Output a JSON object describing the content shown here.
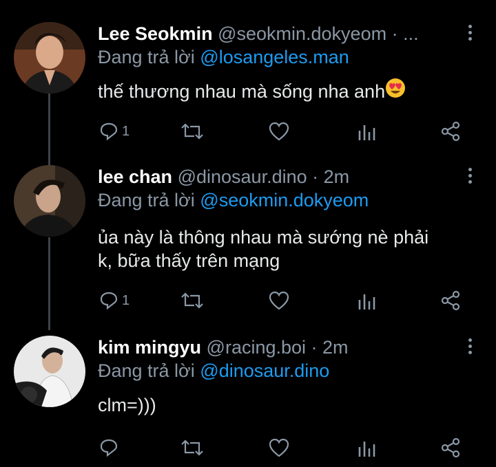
{
  "tweets": [
    {
      "name": "Lee Seokmin",
      "handle": "@seokmin.dokyeom · ...",
      "reply_prefix": "Đang trả lời",
      "reply_to": "@losangeles.man",
      "text": "thế thương nhau mà sống nha anh",
      "emoji": "heart-eyes-emoji",
      "reply_count": "1",
      "retweet_count": "",
      "like_count": ""
    },
    {
      "name": "lee chan",
      "handle": "@dinosaur.dino · 2m",
      "reply_prefix": "Đang trả lời",
      "reply_to": "@seokmin.dokyeom",
      "text_line1": "ủa này là thông nhau mà sướng nè phải",
      "text_line2": "k, bữa thấy trên mạng",
      "reply_count": "1",
      "retweet_count": "",
      "like_count": ""
    },
    {
      "name": "kim mingyu",
      "handle": "@racing.boi · 2m",
      "reply_prefix": "Đang trả lời",
      "reply_to": "@dinosaur.dino",
      "text": "clm=)))",
      "reply_count": "",
      "retweet_count": "",
      "like_count": ""
    }
  ],
  "colors": {
    "background": "#000000",
    "text": "#e7e9ea",
    "muted": "#8b98a5",
    "link": "#1d9bf0",
    "thread_line": "#3d4348"
  }
}
